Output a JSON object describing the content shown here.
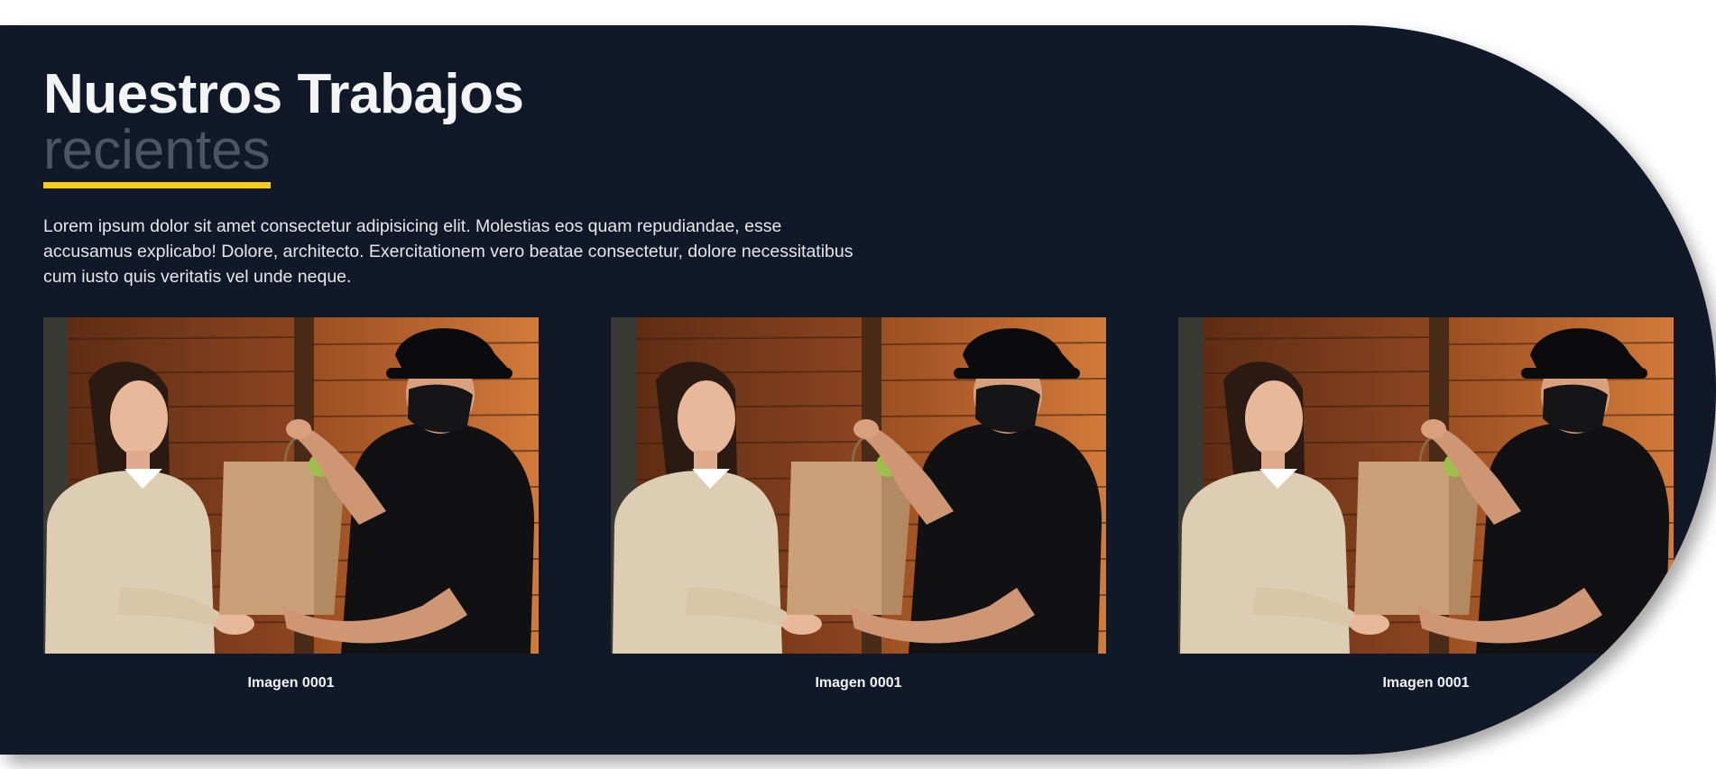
{
  "section": {
    "title": "Nuestros Trabajos",
    "subtitle": "recientes",
    "description": "Lorem ipsum dolor sit amet consectetur adipisicing elit. Molestias eos quam repudiandae, esse accusamus explicabo! Dolore, architecto. Exercitationem vero beatae consectetur, dolore necessitatibus cum iusto quis veritatis vel unde neque."
  },
  "colors": {
    "panel_bg": "#111827",
    "accent_underline": "#facc15",
    "subtitle": "#4b5563",
    "text": "#e5e7eb"
  },
  "gallery": {
    "items": [
      {
        "caption": "Imagen 0001",
        "image": "delivery-photo"
      },
      {
        "caption": "Imagen 0001",
        "image": "delivery-photo"
      },
      {
        "caption": "Imagen 0001",
        "image": "delivery-photo"
      }
    ]
  }
}
